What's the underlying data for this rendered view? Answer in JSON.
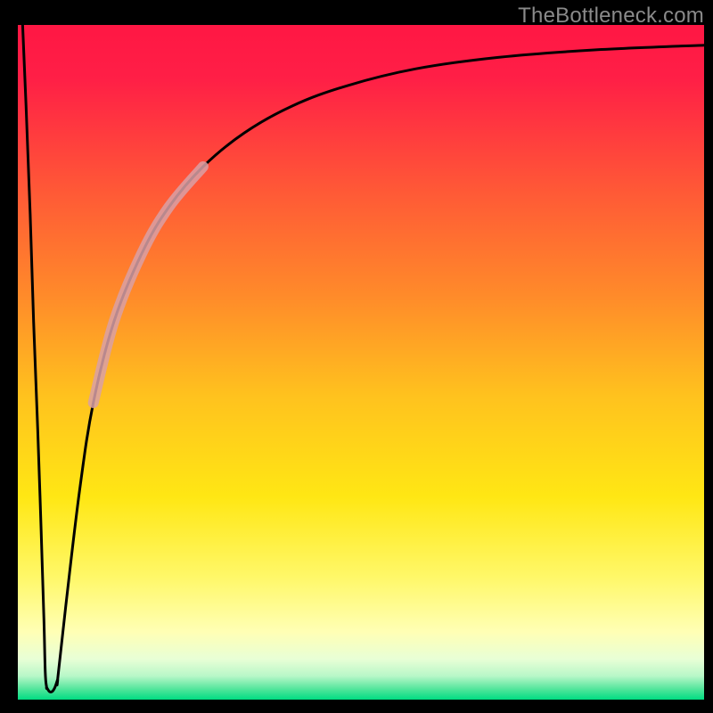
{
  "watermark": "TheBottleneck.com",
  "chart_data": {
    "type": "line",
    "title": "",
    "xlabel": "",
    "ylabel": "",
    "xlim": [
      0,
      100
    ],
    "ylim": [
      0,
      100
    ],
    "grid": false,
    "background_gradient_stops": [
      {
        "offset": 0.0,
        "color": "#ff1744"
      },
      {
        "offset": 0.08,
        "color": "#ff1f46"
      },
      {
        "offset": 0.25,
        "color": "#ff5a36"
      },
      {
        "offset": 0.4,
        "color": "#ff8a2a"
      },
      {
        "offset": 0.55,
        "color": "#ffc21e"
      },
      {
        "offset": 0.7,
        "color": "#ffe714"
      },
      {
        "offset": 0.82,
        "color": "#fff86a"
      },
      {
        "offset": 0.9,
        "color": "#ffffb5"
      },
      {
        "offset": 0.94,
        "color": "#e8ffd6"
      },
      {
        "offset": 0.965,
        "color": "#b8f7c8"
      },
      {
        "offset": 0.985,
        "color": "#4fe59a"
      },
      {
        "offset": 1.0,
        "color": "#00dc82"
      }
    ],
    "series": [
      {
        "name": "left-descending-branch",
        "x": [
          0.7,
          1.2,
          1.8,
          2.3,
          2.9,
          3.4,
          3.8,
          4.0,
          4.2
        ],
        "y": [
          100,
          88,
          72,
          56,
          40,
          25,
          12,
          4,
          1.8
        ]
      },
      {
        "name": "trough",
        "x": [
          4.2,
          4.6,
          5.0,
          5.4,
          5.8
        ],
        "y": [
          1.8,
          1.2,
          1.2,
          1.8,
          3.0
        ]
      },
      {
        "name": "right-rising-branch",
        "x": [
          5.8,
          7.0,
          9.0,
          11.0,
          14.0,
          18.0,
          22.0,
          27.0,
          33.0,
          40.0,
          48.0,
          58.0,
          70.0,
          84.0,
          100.0
        ],
        "y": [
          3.0,
          14,
          31,
          44,
          56,
          66,
          73,
          79,
          84,
          88,
          91,
          93.5,
          95.2,
          96.3,
          97.0
        ]
      }
    ],
    "highlight_segment": {
      "x_start": 14.0,
      "x_end": 22.0,
      "note": "pale pink thicker overlay on curve"
    }
  }
}
